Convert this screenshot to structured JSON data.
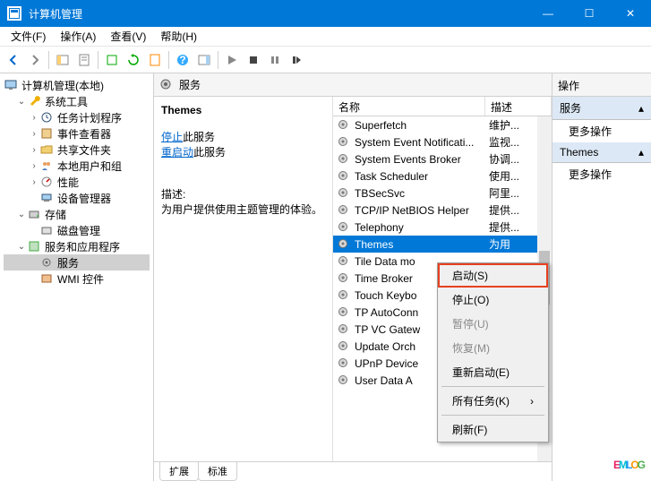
{
  "window": {
    "title": "计算机管理",
    "min": "—",
    "max": "☐",
    "close": "✕"
  },
  "menu": {
    "file": "文件(F)",
    "action": "操作(A)",
    "view": "查看(V)",
    "help": "帮助(H)"
  },
  "tree": {
    "root": "计算机管理(本地)",
    "systools": "系统工具",
    "scheduler": "任务计划程序",
    "eventviewer": "事件查看器",
    "sharedfolders": "共享文件夹",
    "localusers": "本地用户和组",
    "performance": "性能",
    "devmgr": "设备管理器",
    "storage": "存储",
    "diskmgr": "磁盘管理",
    "servicesapps": "服务和应用程序",
    "services": "服务",
    "wmi": "WMI 控件"
  },
  "serviceHeader": "服务",
  "detail": {
    "name": "Themes",
    "stopPrefix": "停止",
    "stopSuffix": "此服务",
    "restartPrefix": "重启动",
    "restartSuffix": "此服务",
    "descLabel": "描述:",
    "descText": "为用户提供使用主题管理的体验。"
  },
  "columns": {
    "name": "名称",
    "desc": "描述"
  },
  "services": [
    {
      "name": "Superfetch",
      "desc": "维护..."
    },
    {
      "name": "System Event Notificati...",
      "desc": "监视..."
    },
    {
      "name": "System Events Broker",
      "desc": "协调..."
    },
    {
      "name": "Task Scheduler",
      "desc": "使用..."
    },
    {
      "name": "TBSecSvc",
      "desc": "阿里..."
    },
    {
      "name": "TCP/IP NetBIOS Helper",
      "desc": "提供..."
    },
    {
      "name": "Telephony",
      "desc": "提供..."
    },
    {
      "name": "Themes",
      "desc": "为用",
      "selected": true
    },
    {
      "name": "Tile Data mo",
      "desc": ""
    },
    {
      "name": "Time Broker",
      "desc": ""
    },
    {
      "name": "Touch Keybo",
      "desc": ""
    },
    {
      "name": "TP AutoConn",
      "desc": ""
    },
    {
      "name": "TP VC Gatew",
      "desc": ""
    },
    {
      "name": "Update Orch",
      "desc": ""
    },
    {
      "name": "UPnP Device",
      "desc": ""
    },
    {
      "name": "User Data A",
      "desc": ""
    }
  ],
  "tabs": {
    "extended": "扩展",
    "standard": "标准"
  },
  "actions": {
    "title": "操作",
    "servicesGroup": "服务",
    "more1": "更多操作",
    "themesGroup": "Themes",
    "more2": "更多操作"
  },
  "context": {
    "start": "启动(S)",
    "stop": "停止(O)",
    "pause": "暂停(U)",
    "resume": "恢复(M)",
    "restart": "重新启动(E)",
    "alltasks": "所有任务(K)",
    "refresh": "刷新(F)",
    "arrow": "›"
  },
  "watermark": "EMLOG"
}
